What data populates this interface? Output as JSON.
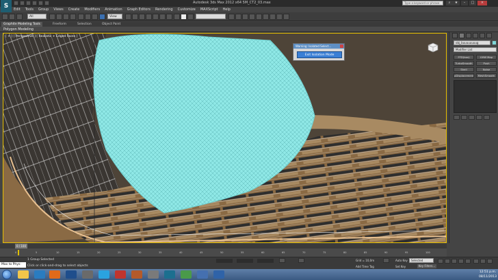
{
  "app": {
    "logo_text": "S",
    "title": "Autodesk 3ds Max  2012 x64    5M_CT2_03.max",
    "search_placeholder": "Type a keyword or phrase"
  },
  "window_controls": {
    "minimize": "–",
    "maximize": "□",
    "close": "×"
  },
  "menu": [
    "Edit",
    "Tools",
    "Group",
    "Views",
    "Create",
    "Modifiers",
    "Animation",
    "Graph Editors",
    "Rendering",
    "Customize",
    "MAXScript",
    "Help"
  ],
  "toolbar": {
    "selection_filter": "All",
    "reference_coord": "View"
  },
  "ribbon": {
    "tabs": [
      "Graphite Modeling Tools",
      "Freeform",
      "Selection",
      "Object Paint"
    ],
    "panel_label": "Polygon Modeling"
  },
  "viewport": {
    "label": "[ + ] [ Perspective ] [ Realistic + Edged Faces ]",
    "viewcube_label": "FRONT",
    "colors": {
      "mesh": "#8fe8e6",
      "floor_wood": "#8a6a44",
      "frame": "#e8c000"
    }
  },
  "isolate_dialog": {
    "title": "Warning: Isolated Select...",
    "button": "Exit Isolation Mode"
  },
  "command_panel": {
    "object_name": "obj_buuuuuuuug",
    "object_color": "#7fd6d8",
    "modifier_list": "Modifier List",
    "modifier_buttons": [
      "FFD(box)",
      "UVW Map",
      "TurboSmooth",
      "Push",
      "Shell",
      "Noise",
      "pDisplacement",
      "MeshSmooth"
    ]
  },
  "timeline": {
    "current": "0 / 100",
    "frames": [
      "0",
      "5",
      "10",
      "15",
      "20",
      "25",
      "30",
      "35",
      "40",
      "45",
      "50",
      "55",
      "60",
      "65",
      "70",
      "75",
      "80",
      "85",
      "90",
      "95",
      "100"
    ]
  },
  "status": {
    "listener": "Max to Phys:",
    "line1": "1 Group Selected",
    "line2": "Click or click-and-drag to select objects",
    "grid": "Grid = 10,0m",
    "add_time_tag": "Add Time Tag",
    "auto_key": "Auto Key",
    "auto_key_value": "Selected",
    "set_key": "Set Key",
    "key_filters": "Key Filters..."
  },
  "taskbar": {
    "time": "12:51 p.m.",
    "date": "08/11/2013"
  }
}
